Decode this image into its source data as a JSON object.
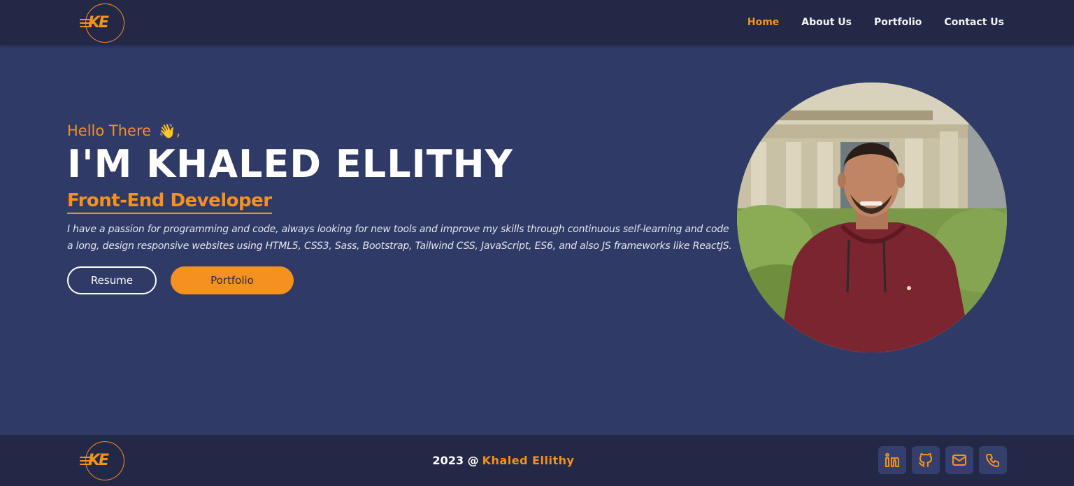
{
  "brand": {
    "logo_text": "KE"
  },
  "nav": {
    "items": [
      {
        "label": "Home",
        "active": true
      },
      {
        "label": "About Us",
        "active": false
      },
      {
        "label": "Portfolio",
        "active": false
      },
      {
        "label": "Contact Us",
        "active": false
      }
    ]
  },
  "hero": {
    "greeting": "Hello There",
    "greeting_emoji": "👋",
    "greeting_suffix": ",",
    "name": "I'M KHALED ELLITHY",
    "role": "Front-End Developer",
    "bio": "I have a passion for programming and code, always looking for new tools and improve my skills through continuous self-learning and code a long, design responsive websites using HTML5, CSS3, Sass, Bootstrap, Tailwind CSS, JavaScript, ES6, and also JS frameworks like ReactJS.",
    "resume_label": "Resume",
    "portfolio_label": "Portfolio",
    "portrait": "profile-photo"
  },
  "footer": {
    "year": "2023 @",
    "owner": "Khaled Ellithy",
    "socials": [
      {
        "icon": "linkedin-icon"
      },
      {
        "icon": "github-icon"
      },
      {
        "icon": "mail-icon"
      },
      {
        "icon": "phone-icon"
      }
    ]
  },
  "colors": {
    "accent": "#f4921f",
    "background": "#2f3a66",
    "bar": "#242847",
    "social_tile": "#343f6e"
  }
}
